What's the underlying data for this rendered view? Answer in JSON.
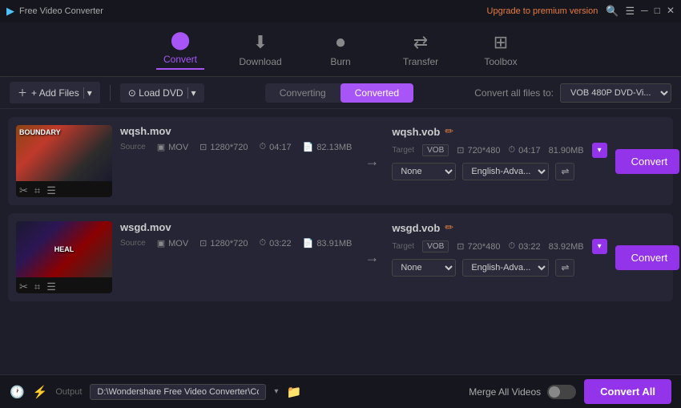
{
  "titlebar": {
    "app_name": "Free Video Converter",
    "upgrade_text": "Upgrade to premium version",
    "search_icon": "🔍",
    "menu_icon": "☰",
    "minimize_icon": "─",
    "maximize_icon": "□",
    "close_icon": "✕"
  },
  "navbar": {
    "items": [
      {
        "id": "convert",
        "label": "Convert",
        "icon": "▶",
        "active": true
      },
      {
        "id": "download",
        "label": "Download",
        "icon": "⬇",
        "active": false
      },
      {
        "id": "burn",
        "label": "Burn",
        "icon": "⏺",
        "active": false
      },
      {
        "id": "transfer",
        "label": "Transfer",
        "icon": "⇄",
        "active": false
      },
      {
        "id": "toolbox",
        "label": "Toolbox",
        "icon": "⊞",
        "active": false
      }
    ]
  },
  "toolbar": {
    "add_files": "+ Add Files",
    "load_dvd": "⊙ Load DVD",
    "tab_converting": "Converting",
    "tab_converted": "Converted",
    "convert_all_to_label": "Convert all files to:",
    "format_value": "VOB 480P DVD-Vi..."
  },
  "files": [
    {
      "source_name": "wqsh.mov",
      "target_name": "wqsh.vob",
      "thumbnail_type": "grad1",
      "thumbnail_text": "BOUNDARY",
      "source": {
        "format": "MOV",
        "resolution": "1280*720",
        "duration": "04:17",
        "size": "82.13MB"
      },
      "target": {
        "format": "VOB",
        "resolution": "720*480",
        "duration": "04:17",
        "size": "81.90MB"
      },
      "subtitle_option": "None",
      "audio_option": "English-Adva...",
      "convert_btn": "Convert"
    },
    {
      "source_name": "wsgd.mov",
      "target_name": "wsgd.vob",
      "thumbnail_type": "grad2",
      "thumbnail_text": "HEAL",
      "source": {
        "format": "MOV",
        "resolution": "1280*720",
        "duration": "03:22",
        "size": "83.91MB"
      },
      "target": {
        "format": "VOB",
        "resolution": "720*480",
        "duration": "03:22",
        "size": "83.92MB"
      },
      "subtitle_option": "None",
      "audio_option": "English-Adva...",
      "convert_btn": "Convert"
    }
  ],
  "footer": {
    "output_label": "Output",
    "output_path": "D:\\Wondershare Free Video Converter\\Converted",
    "merge_videos_label": "Merge All Videos",
    "convert_all_btn": "Convert All"
  }
}
